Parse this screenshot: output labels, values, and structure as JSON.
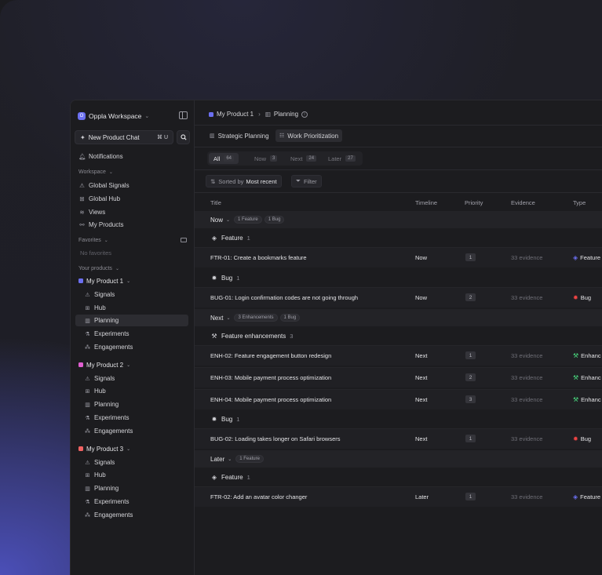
{
  "workspace": {
    "logo": "O",
    "name": "Oppla Workspace"
  },
  "sidebar": {
    "chat_label": "New Product Chat",
    "chat_shortcut": "⌘ U",
    "notifications": "Notifications",
    "workspace_label": "Workspace",
    "workspace_items": [
      "Global Signals",
      "Global Hub",
      "Views",
      "My Products"
    ],
    "favorites_label": "Favorites",
    "no_favorites": "No favorites",
    "products_label": "Your products",
    "products": [
      {
        "name": "My Product 1",
        "color": "#6b6ff0",
        "items": [
          "Signals",
          "Hub",
          "Planning",
          "Experiments",
          "Engagements"
        ]
      },
      {
        "name": "My Product 2",
        "color": "#e05fd0",
        "items": [
          "Signals",
          "Hub",
          "Planning",
          "Experiments",
          "Engagements"
        ]
      },
      {
        "name": "My Product 3",
        "color": "#f06262",
        "items": [
          "Signals",
          "Hub",
          "Planning",
          "Experiments",
          "Engagements"
        ]
      }
    ]
  },
  "breadcrumb": {
    "product": "My Product 1",
    "page": "Planning",
    "info": "i"
  },
  "tabs": [
    "Strategic Planning",
    "Work Prioritization"
  ],
  "filters": [
    {
      "label": "All",
      "count": "64"
    },
    {
      "label": "Now",
      "count": "3"
    },
    {
      "label": "Next",
      "count": "24"
    },
    {
      "label": "Later",
      "count": "27"
    }
  ],
  "toolbar": {
    "sort_prefix": "Sorted by",
    "sort_value": "Most recent",
    "filter": "Filter"
  },
  "columns": [
    "Title",
    "Timeline",
    "Priority",
    "Evidence",
    "Type"
  ],
  "groups": {
    "now": {
      "label": "Now",
      "pills": [
        "1 Feature",
        "1 Bug"
      ]
    },
    "next": {
      "label": "Next",
      "pills": [
        "3 Enhancements",
        "1 Bug"
      ]
    },
    "later": {
      "label": "Later",
      "pills": [
        "1 Feature"
      ]
    }
  },
  "subgroups": {
    "feature": "Feature",
    "bug": "Bug",
    "enh": "Feature enhancements",
    "feature_n": "1",
    "bug_n": "1",
    "enh_n": "3"
  },
  "rows": [
    {
      "title": "FTR-01: Create a bookmarks feature",
      "timeline": "Now",
      "priority": "1",
      "evidence": "33 evidence",
      "type": "Feature"
    },
    {
      "title": "BUG-01: Login confirmation codes are not going through",
      "timeline": "Now",
      "priority": "2",
      "evidence": "33 evidence",
      "type": "Bug"
    },
    {
      "title": "ENH-02: Feature engagement button redesign",
      "timeline": "Next",
      "priority": "1",
      "evidence": "33 evidence",
      "type": "Enhanc"
    },
    {
      "title": "ENH-03: Mobile payment process optimization",
      "timeline": "Next",
      "priority": "2",
      "evidence": "33 evidence",
      "type": "Enhanc"
    },
    {
      "title": "ENH-04: Mobile payment process optimization",
      "timeline": "Next",
      "priority": "3",
      "evidence": "33 evidence",
      "type": "Enhanc"
    },
    {
      "title": "BUG-02: Loading takes longer on Safari browsers",
      "timeline": "Next",
      "priority": "1",
      "evidence": "33 evidence",
      "type": "Bug"
    },
    {
      "title": "FTR-02: Add an avatar color changer",
      "timeline": "Later",
      "priority": "1",
      "evidence": "33 evidence",
      "type": "Feature"
    }
  ]
}
